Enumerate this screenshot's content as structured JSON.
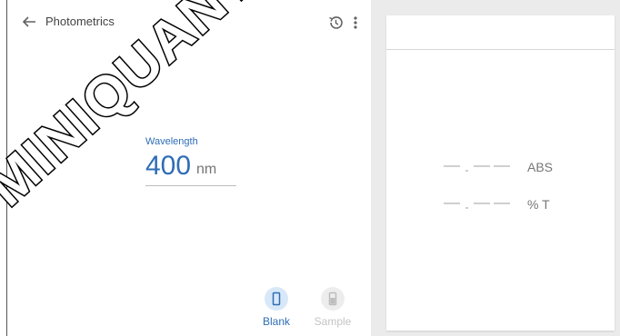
{
  "app": {
    "title": "Photometrics"
  },
  "wavelength": {
    "label": "Wavelength",
    "value": "400",
    "unit": "nm"
  },
  "modes": [
    {
      "label": "Blank",
      "active": true
    },
    {
      "label": "Sample",
      "active": false
    }
  ],
  "results": {
    "absorbance": {
      "placeholder": "-.---",
      "unit": "ABS"
    },
    "transmittance": {
      "placeholder": "-.---",
      "unit": "% T"
    }
  },
  "watermark": {
    "text": "MINIQUANT"
  },
  "colors": {
    "accent": "#2f6db6",
    "muted": "#c4c4c4",
    "background": "#ebebeb"
  },
  "icons": {
    "back": "arrow-left-icon",
    "history": "history-icon",
    "menu": "more-vert-icon",
    "blank": "cuvette-icon",
    "sample": "sample-cuvette-icon"
  }
}
